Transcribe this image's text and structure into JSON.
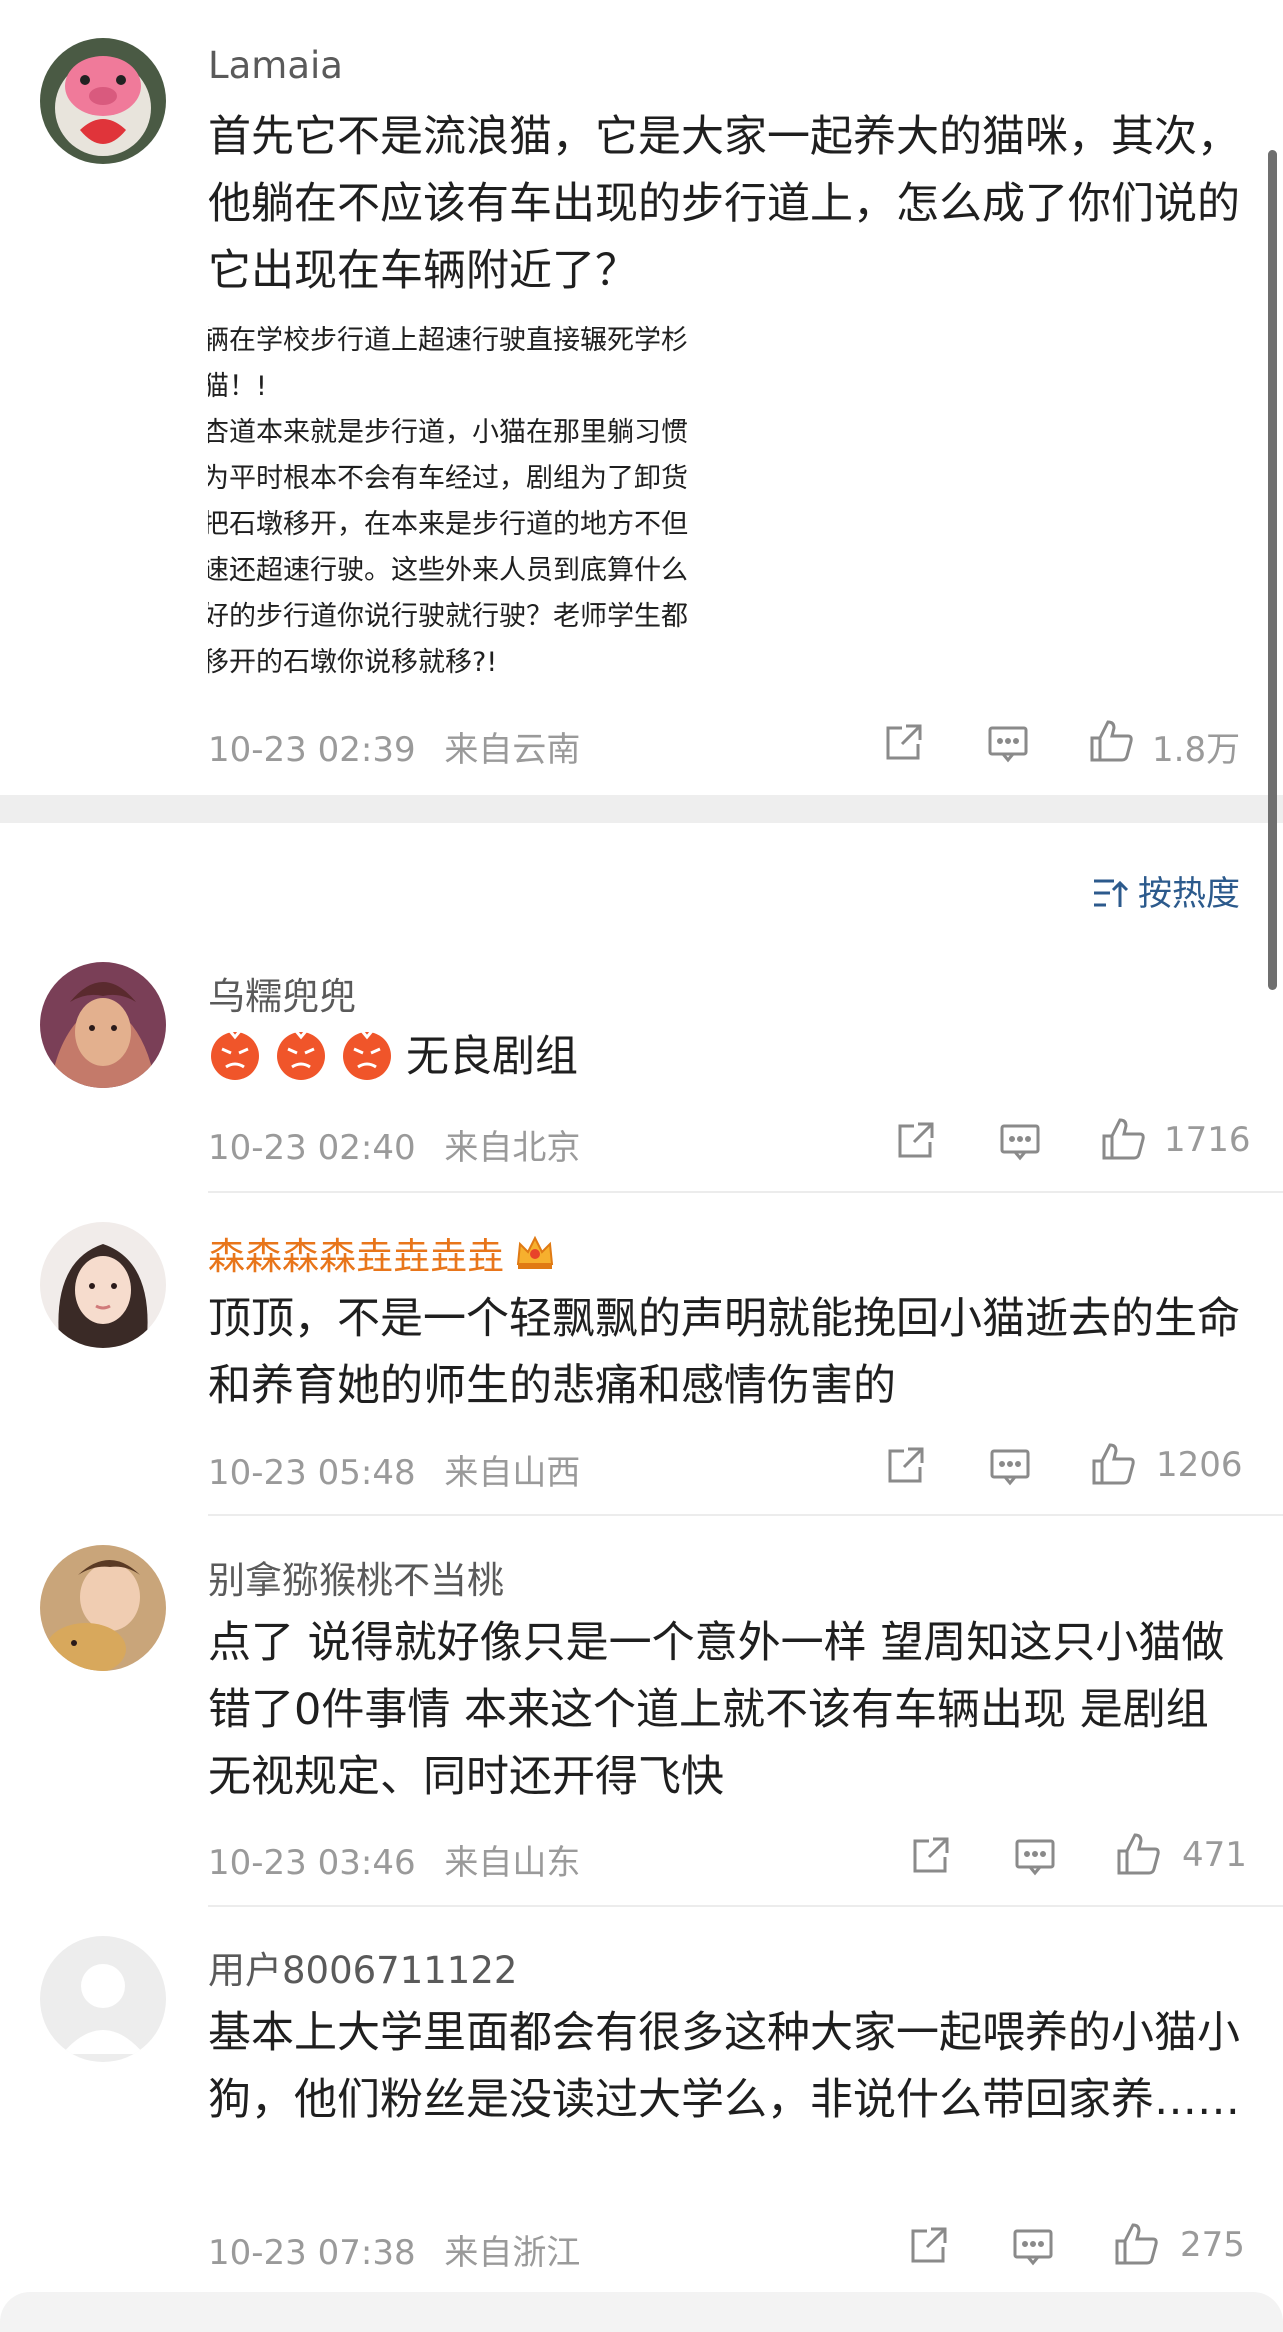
{
  "comments": [
    {
      "username": "Lamaia",
      "text": "首先它不是流浪猫，它是大家一起养大的猫咪，其次，他躺在不应该有车出现的步行道上，怎么成了你们说的它出现在车辆附近了？",
      "quote_lines": [
        "辆在学校步行道上超速行驶直接辗死学杉",
        "猫！!",
        "杏道本来就是步行道，小猫在那里躺习惯",
        "为平时根本不会有车经过，剧组为了卸货",
        "把石墩移开，在本来是步行道的地方不但",
        "速还超速行驶。这些外来人员到底算什么",
        "好的步行道你说行驶就行驶？老师学生都",
        "移开的石墩你说移就移?!"
      ],
      "time": "10-23 02:39",
      "location": "来自云南",
      "likes": "1.8万"
    },
    {
      "username": "乌糯兜兜",
      "text": "无良剧组",
      "emoji": "angry-face",
      "time": "10-23 02:40",
      "location": "来自北京",
      "likes": "1716"
    },
    {
      "username": "森森森森垚垚垚垚",
      "badge": "crown",
      "text": "顶顶，不是一个轻飘飘的声明就能挽回小猫逝去的生命和养育她的师生的悲痛和感情伤害的",
      "time": "10-23 05:48",
      "location": "来自山西",
      "likes": "1206"
    },
    {
      "username": "别拿猕猴桃不当桃",
      "text": "点了 说得就好像只是一个意外一样 望周知这只小猫做错了0件事情 本来这个道上就不该有车辆出现 是剧组无视规定、同时还开得飞快",
      "time": "10-23 03:46",
      "location": "来自山东",
      "likes": "471"
    },
    {
      "username": "用户8006711122",
      "text": "基本上大学里面都会有很多这种大家一起喂养的小猫小狗，他们粉丝是没读过大学么，非说什么带回家养……",
      "time": "10-23 07:38",
      "location": "来自浙江",
      "likes": "275"
    }
  ],
  "sort": {
    "label": "按热度",
    "icon": "sort-icon"
  },
  "icons": [
    "share-icon",
    "comment-icon",
    "like-icon"
  ],
  "colors": {
    "accent": "#2c5a8c",
    "username_gold": "#e8751a",
    "meta": "#9a9a9a"
  }
}
